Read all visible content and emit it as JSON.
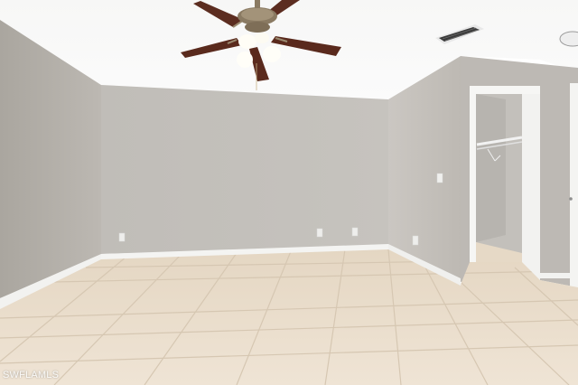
{
  "photo": {
    "watermark": "SWFLAMLS"
  },
  "colors": {
    "ceiling": "#fafafa",
    "wall_left": "#b4b0ab",
    "wall_back": "#c2bfba",
    "wall_right": "#c7c3be",
    "closet_wall": "#bfbcb8",
    "baseboard": "#f2f2f0",
    "floor_tile": "#e9ddcc",
    "grout": "#d9cbb8",
    "door_trim": "#f6f6f4",
    "fan_blade": "#5c2d20",
    "fan_housing": "#8a7a62",
    "vent": "#3a3a3a"
  },
  "objects": {
    "ceiling_fan": "ceiling-fan-with-light-kit",
    "vent": "ceiling-air-vent",
    "closet": "walk-in-closet-with-wire-shelf",
    "outlets": "wall-outlets",
    "switch": "light-switch"
  }
}
